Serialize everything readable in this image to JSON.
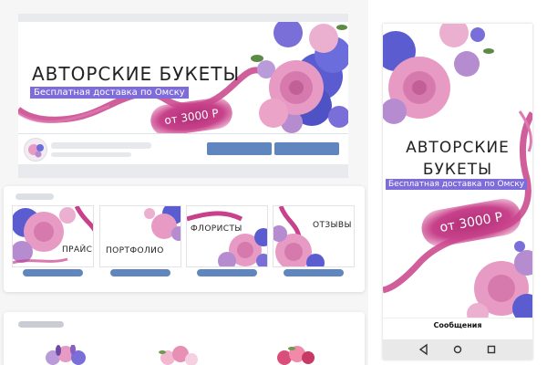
{
  "cover": {
    "title": "АВТОРСКИЕ БУКЕТЫ",
    "subtitle": "Бесплатная доставка по Омску",
    "price": "от 3000 Р"
  },
  "menu": {
    "tiles": [
      {
        "label": "ПРАЙС"
      },
      {
        "label": "ПОРТФОЛИО"
      },
      {
        "label": "ФЛОРИСТЫ"
      },
      {
        "label": "ОТЗЫВЫ"
      }
    ]
  },
  "phone": {
    "title_line1": "АВТОРСКИЕ",
    "title_line2": "БУКЕТЫ",
    "subtitle": "Бесплатная доставка по Омску",
    "price": "от 3000 Р",
    "messages_label": "Сообщения",
    "nav": [
      "back-icon",
      "home-icon",
      "recents-icon"
    ]
  },
  "colors": {
    "accent_purple": "#7d6cd9",
    "ribbon_pink": "#c7428a",
    "vk_button_blue": "#5f86be",
    "rose_pink": "#e79bc4",
    "hydrangea_blue": "#5a5ccf"
  }
}
